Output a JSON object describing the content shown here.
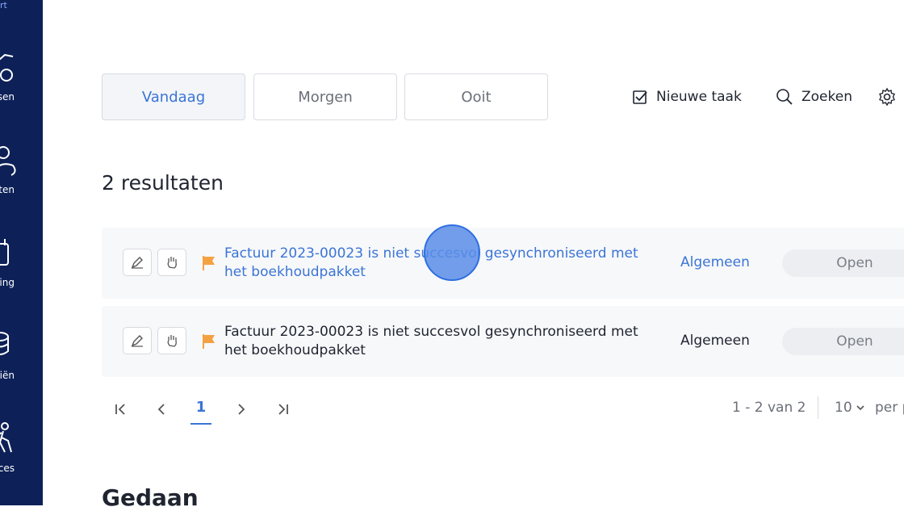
{
  "sidebar": {
    "top_label": "rt",
    "items": [
      {
        "label": "sen",
        "icon": "glasses-icon"
      },
      {
        "label": "ten",
        "icon": "contacts-icon"
      },
      {
        "label": "ning",
        "icon": "planning-icon"
      },
      {
        "label": "ciën",
        "icon": "finance-icon"
      },
      {
        "label": "rces",
        "icon": "resources-icon"
      }
    ]
  },
  "tabs": [
    {
      "label": "Vandaag",
      "active": true
    },
    {
      "label": "Morgen",
      "active": false
    },
    {
      "label": "Ooit",
      "active": false
    }
  ],
  "toolbar": {
    "new_task_label": "Nieuwe taak",
    "search_label": "Zoeken"
  },
  "results_title": "2 resultaten",
  "rows": [
    {
      "title_line1": "Factuur 2023-00023 is niet succesvol gesynchroniseerd met",
      "title_line2": "het boekhoudpakket",
      "category": "Algemeen",
      "status": "Open"
    },
    {
      "title_line1": "Factuur 2023-00023 is niet succesvol gesynchroniseerd met",
      "title_line2": "het boekhoudpakket",
      "category": "Algemeen",
      "status": "Open"
    }
  ],
  "pagination": {
    "current_page": "1",
    "range_text": "1 - 2 van 2",
    "page_size": "10",
    "per_page_label": "per p"
  },
  "done_title": "Gedaan",
  "colors": {
    "sidebar_bg": "#0d2158",
    "accent": "#3b74d6",
    "flag": "#f5a142"
  }
}
